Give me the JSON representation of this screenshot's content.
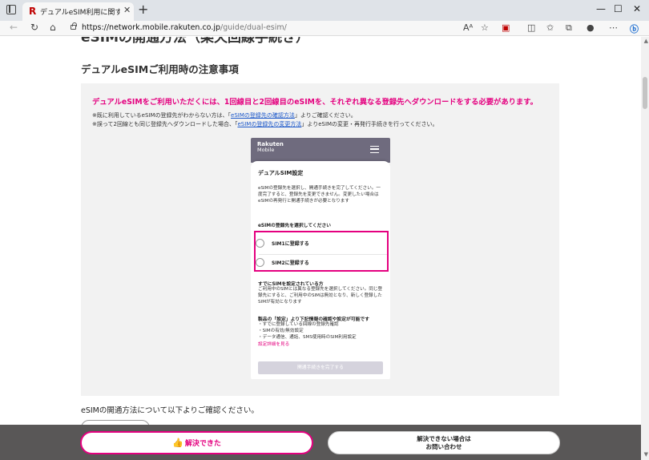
{
  "browser": {
    "tab_title": "デュアルeSIM利用に関する設定方法",
    "tab_favicon": "R",
    "url_host": "https://network.mobile.rakuten.co.jp",
    "url_path": "/guide/dual-esim/"
  },
  "page": {
    "top_heading": "eSIMの開通方法（楽天回線手続き）",
    "sub_heading": "デュアルeSIMご利用時の注意事項",
    "notice": {
      "lead": "デュアルeSIMをご利用いただくには、1回線目と2回線目のeSIMを、それぞれ異なる登録先へダウンロードをする必要があります。",
      "line1_prefix": "※既に利用しているeSIMの登録先がわからない方は、「",
      "line1_link": "eSIMの登録先の確認方法",
      "line1_suffix": "」よりご確認ください。",
      "line2_prefix": "※誤って2回線とも同じ登録先へダウンロードした場合、「",
      "line2_link": "eSIMの登録先の変更方法",
      "line2_suffix": "」よりeSIMの変更・再発行手続きを行ってください。"
    },
    "phone": {
      "logo_top": "Rakuten",
      "logo_bottom": "Mobile",
      "title": "デュアルSIM設定",
      "desc": "eSIMの登録先を選択し、開通手続きを完了してください。一度完了すると、登録先を変更できません。変更したい場合はeSIMの再発行と開通手続きが必要となります",
      "select_label": "eSIMの登録先を選択してください",
      "options": [
        "SIM1に登録する",
        "SIM2に登録する"
      ],
      "already_title": "すでにSIMを設定されている方",
      "already_desc": "ご利用中のSIMとは異なる登録先を選択してください。同じ登録先にすると、ご利用中のSIMは無効となり、新しく登録したSIMが有効となります",
      "settings_title": "製品の「設定」より下記情報の確認や設定が可能です",
      "settings_items": [
        "・すでに登録している回線の登録先確認",
        "・SIMの有効/無効設定",
        "・データ通信、通話、SMS使用時のSIM利用設定"
      ],
      "settings_link": "設定詳細を見る",
      "complete_button": "開通手続きを完了する"
    },
    "after_text": "eSIMの開通方法について以下よりご確認ください。"
  },
  "bottom_bar": {
    "solved_label": "解決できた",
    "contact_line1": "解決できない場合は",
    "contact_line2": "お問い合わせ"
  },
  "colors": {
    "brand_pink": "#e4007f",
    "phone_header": "#6f6b7e",
    "bottom_bar": "#595757"
  }
}
